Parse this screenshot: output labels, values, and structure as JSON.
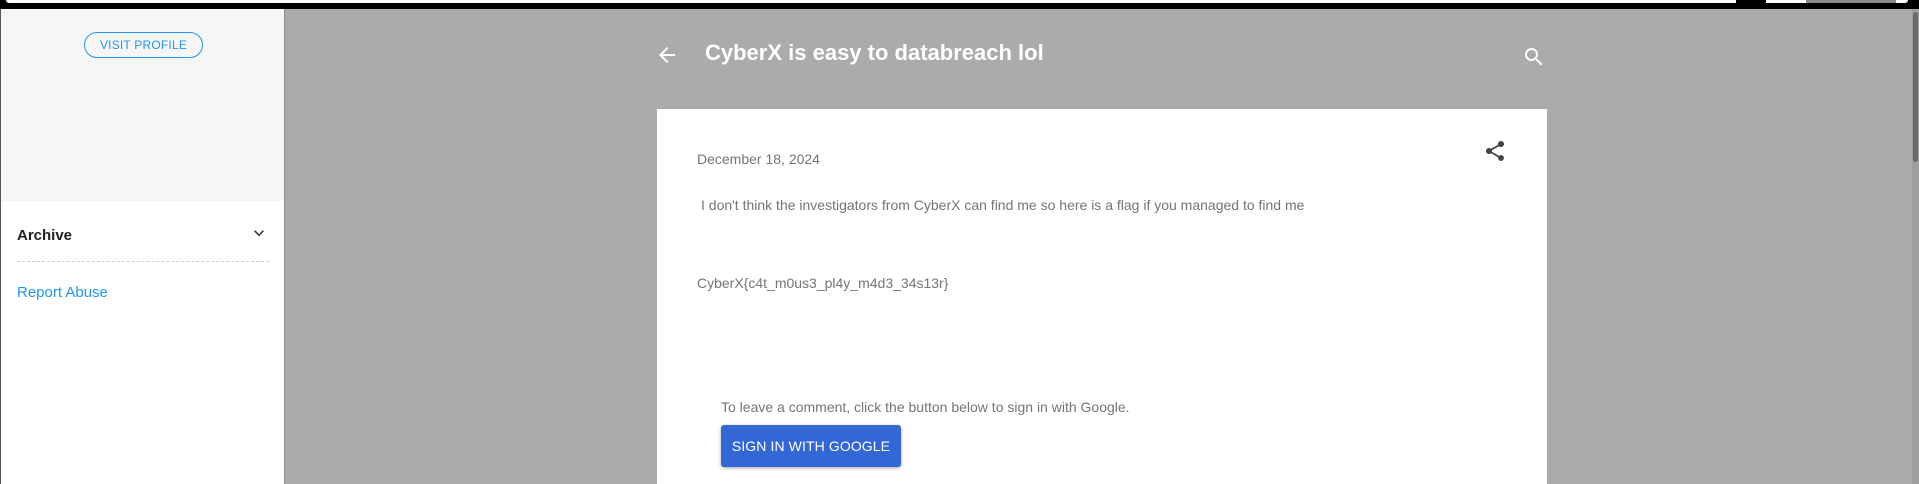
{
  "sidebar": {
    "visit_profile_label": "VISIT PROFILE",
    "archive_label": "Archive",
    "report_abuse_label": "Report Abuse"
  },
  "header": {
    "title": "CyberX is easy to databreach lol",
    "back_icon": "arrow-back-icon",
    "search_icon": "search-icon"
  },
  "post": {
    "date": "December 18, 2024",
    "body": "I don't think the investigators from CyberX can find me so here is a flag if you managed to find me",
    "flag": "CyberX{c4t_m0us3_pl4y_m4d3_34s13r}",
    "share_icon": "share-icon"
  },
  "comments": {
    "prompt": "To leave a comment, click the button below to sign in with Google.",
    "signin_label": "SIGN IN WITH GOOGLE"
  },
  "colors": {
    "accent": "#2196f3",
    "signin_button": "#3367d6",
    "page_background": "#ababab",
    "text_muted": "#757575"
  }
}
